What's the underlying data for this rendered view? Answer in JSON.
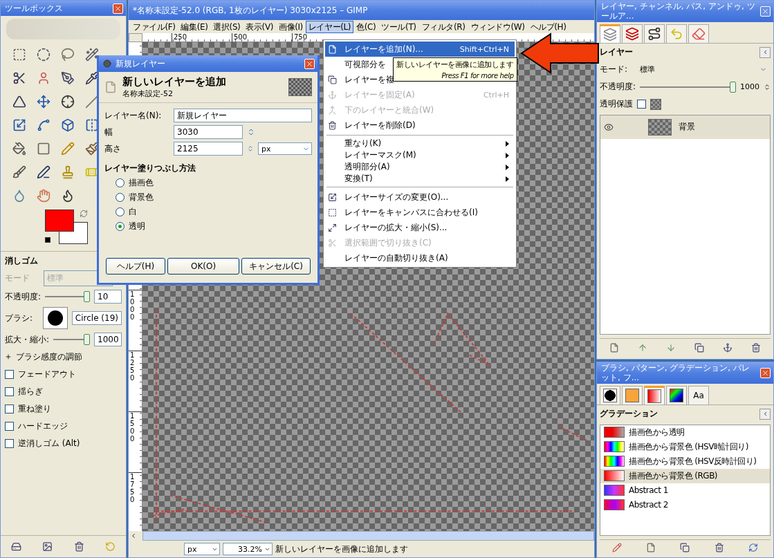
{
  "toolbox": {
    "title": "ツールボックス",
    "tool_options": {
      "title": "消しゴム",
      "mode": {
        "label": "モード",
        "value": "標準",
        "disabled": true
      },
      "opacity": {
        "label": "不透明度:",
        "value": "10",
        "level": 1
      },
      "brush": {
        "label": "ブラシ:",
        "value": "Circle (19)"
      },
      "scale": {
        "label": "拡大・縮小:",
        "value": "1000",
        "level": 1
      },
      "expander": {
        "label": "ブラシ感度の調節",
        "expanded": false
      },
      "options": [
        {
          "label": "フェードアウト",
          "checked": false
        },
        {
          "label": "揺らぎ",
          "checked": false
        },
        {
          "label": "重ね塗り",
          "checked": false
        },
        {
          "label": "ハードエッジ",
          "checked": false
        },
        {
          "label": "逆消しゴム (Alt)",
          "checked": false
        }
      ]
    }
  },
  "image_window": {
    "title": "*名称未設定-52.0 (RGB, 1枚のレイヤー) 3030x2125 – GIMP",
    "menu": [
      {
        "label": "ファイル(F)",
        "selected": false
      },
      {
        "label": "編集(E)",
        "selected": false
      },
      {
        "label": "選択(S)",
        "selected": false
      },
      {
        "label": "表示(V)",
        "selected": false
      },
      {
        "label": "画像(I)",
        "selected": false
      },
      {
        "label": "レイヤー(L)",
        "selected": true
      },
      {
        "label": "色(C)",
        "selected": false
      },
      {
        "label": "ツール(T)",
        "selected": false
      },
      {
        "label": "フィルタ(R)",
        "selected": false
      },
      {
        "label": "ウィンドウ(W)",
        "selected": false
      },
      {
        "label": "ヘルプ(H)",
        "selected": false
      }
    ],
    "top_ruler": [
      "250",
      "500",
      "750"
    ],
    "left_ruler": [
      "1000",
      "1250",
      "1500",
      "1750"
    ],
    "status": {
      "unit": "px",
      "zoom": "33.2%",
      "message": "新しいレイヤーを画像に追加します"
    }
  },
  "layer_menu": {
    "items": [
      {
        "kind": "item",
        "label": "レイヤーを追加(N)...",
        "shortcut": "Shift+Ctrl+N",
        "selected": true,
        "disabled": false
      },
      {
        "kind": "item",
        "label": "可視部分を",
        "selected": false,
        "disabled": false
      },
      {
        "kind": "item",
        "label": "レイヤーを複",
        "selected": false,
        "disabled": false
      },
      {
        "kind": "item",
        "label": "レイヤーを固定(A)",
        "shortcut": "Ctrl+H",
        "selected": false,
        "disabled": true
      },
      {
        "kind": "item",
        "label": "下のレイヤーと統合(W)",
        "selected": false,
        "disabled": true
      },
      {
        "kind": "item",
        "label": "レイヤーを削除(D)",
        "selected": false,
        "disabled": false
      },
      {
        "kind": "separator"
      },
      {
        "kind": "submenu",
        "label": "重なり(K)",
        "selected": false,
        "disabled": false
      },
      {
        "kind": "submenu",
        "label": "レイヤーマスク(M)",
        "selected": false,
        "disabled": false
      },
      {
        "kind": "submenu",
        "label": "透明部分(A)",
        "selected": false,
        "disabled": false
      },
      {
        "kind": "submenu",
        "label": "変換(T)",
        "selected": false,
        "disabled": false
      },
      {
        "kind": "separator"
      },
      {
        "kind": "item",
        "label": "レイヤーサイズの変更(O)...",
        "selected": false,
        "disabled": false
      },
      {
        "kind": "item",
        "label": "レイヤーをキャンバスに合わせる(I)",
        "selected": false,
        "disabled": false
      },
      {
        "kind": "item",
        "label": "レイヤーの拡大・縮小(S)...",
        "selected": false,
        "disabled": false
      },
      {
        "kind": "item",
        "label": "選択範囲で切り抜き(C)",
        "selected": false,
        "disabled": true
      },
      {
        "kind": "item",
        "label": "レイヤーの自動切り抜き(A)",
        "selected": false,
        "disabled": false
      }
    ],
    "tooltip": {
      "text": "新しいレイヤーを画像に追加します",
      "hint": "Press F1 for more help"
    }
  },
  "dialog": {
    "title": "新規レイヤー",
    "heading": "新しいレイヤーを追加",
    "subheading": "名称未設定-52",
    "name": {
      "label": "レイヤー名(N):",
      "value": "新規レイヤー"
    },
    "width": {
      "label": "幅",
      "value": "3030"
    },
    "height": {
      "label": "高さ",
      "value": "2125"
    },
    "unit": "px",
    "fill_title": "レイヤー塗りつぶし方法",
    "fill_options": [
      {
        "label": "描画色",
        "selected": false
      },
      {
        "label": "背景色",
        "selected": false
      },
      {
        "label": "白",
        "selected": false
      },
      {
        "label": "透明",
        "selected": true
      }
    ],
    "buttons": [
      "ヘルプ(H)",
      "OK(O)",
      "キャンセル(C)"
    ]
  },
  "layers_dock": {
    "title": "レイヤー, チャンネル, パス, アンドゥ, ツールア...",
    "tabs": [
      {
        "selected": true
      },
      {
        "selected": false
      },
      {
        "selected": false
      },
      {
        "selected": false
      },
      {
        "selected": false
      }
    ],
    "heading": "レイヤー",
    "mode": {
      "label": "モード:",
      "value": "標準"
    },
    "opacity": {
      "label": "不透明度:",
      "value": "1000",
      "level": 1
    },
    "lock": {
      "label": "透明保護",
      "checked": false
    },
    "layers": [
      {
        "name": "背景",
        "visible": true,
        "selected": true
      }
    ]
  },
  "gradients_dock": {
    "title": "ブラシ, パターン, グラデーション, パレット, フ...",
    "tabs": [
      {
        "selected": false
      },
      {
        "selected": false
      },
      {
        "selected": true
      },
      {
        "selected": false
      },
      {
        "label": "Aa",
        "selected": false
      }
    ],
    "heading": "グラデーション",
    "gradients": [
      {
        "name": "描画色から透明",
        "selected": false
      },
      {
        "name": "描画色から背景色 (HSV時計回り)",
        "selected": false
      },
      {
        "name": "描画色から背景色 (HSV反時計回り)",
        "selected": false
      },
      {
        "name": "描画色から背景色 (RGB)",
        "selected": true
      },
      {
        "name": "Abstract 1",
        "selected": false
      },
      {
        "name": "Abstract 2",
        "selected": false
      }
    ]
  }
}
